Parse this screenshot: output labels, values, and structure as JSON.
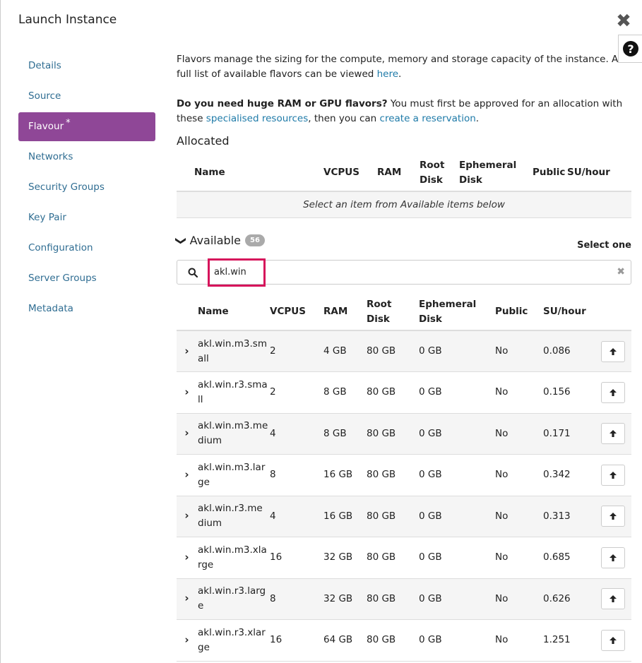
{
  "modal": {
    "title": "Launch Instance",
    "close_icon": "close-icon",
    "help_label": "?"
  },
  "nav": {
    "items": [
      {
        "label": "Details",
        "active": false,
        "required": false
      },
      {
        "label": "Source",
        "active": false,
        "required": false
      },
      {
        "label": "Flavour",
        "active": true,
        "required": true
      },
      {
        "label": "Networks",
        "active": false,
        "required": false
      },
      {
        "label": "Security Groups",
        "active": false,
        "required": false
      },
      {
        "label": "Key Pair",
        "active": false,
        "required": false
      },
      {
        "label": "Configuration",
        "active": false,
        "required": false
      },
      {
        "label": "Server Groups",
        "active": false,
        "required": false
      },
      {
        "label": "Metadata",
        "active": false,
        "required": false
      }
    ],
    "required_mark": "*"
  },
  "intro": {
    "p1_text": "Flavors manage the sizing for the compute, memory and storage capacity of the instance. A full list of available flavors can be viewed ",
    "p1_link": "here",
    "p1_end": ".",
    "p2_bold": "Do you need huge RAM or GPU flavors?",
    "p2_text": " You must first be approved for an allocation with these ",
    "p2_link1": "specialised resources",
    "p2_mid": ", then you can ",
    "p2_link2": "create a reservation",
    "p2_end": "."
  },
  "allocated": {
    "title": "Allocated",
    "columns": [
      "Name",
      "VCPUS",
      "RAM",
      "Root Disk",
      "Ephemeral Disk",
      "Public",
      "SU/hour"
    ],
    "empty_message": "Select an item from Available items below"
  },
  "available": {
    "title": "Available",
    "count": "56",
    "select_hint": "Select one",
    "search": {
      "value": "akl.win",
      "placeholder": ""
    },
    "columns": [
      "Name",
      "VCPUS",
      "RAM",
      "Root Disk",
      "Ephemeral Disk",
      "Public",
      "SU/hour"
    ],
    "rows": [
      {
        "name": "akl.win.m3.small",
        "vcpus": "2",
        "ram": "4 GB",
        "root_disk": "80 GB",
        "ephemeral_disk": "0 GB",
        "public": "No",
        "su_hour": "0.086"
      },
      {
        "name": "akl.win.r3.small",
        "vcpus": "2",
        "ram": "8 GB",
        "root_disk": "80 GB",
        "ephemeral_disk": "0 GB",
        "public": "No",
        "su_hour": "0.156"
      },
      {
        "name": "akl.win.m3.medium",
        "vcpus": "4",
        "ram": "8 GB",
        "root_disk": "80 GB",
        "ephemeral_disk": "0 GB",
        "public": "No",
        "su_hour": "0.171"
      },
      {
        "name": "akl.win.m3.large",
        "vcpus": "8",
        "ram": "16 GB",
        "root_disk": "80 GB",
        "ephemeral_disk": "0 GB",
        "public": "No",
        "su_hour": "0.342"
      },
      {
        "name": "akl.win.r3.medium",
        "vcpus": "4",
        "ram": "16 GB",
        "root_disk": "80 GB",
        "ephemeral_disk": "0 GB",
        "public": "No",
        "su_hour": "0.313"
      },
      {
        "name": "akl.win.m3.xlarge",
        "vcpus": "16",
        "ram": "32 GB",
        "root_disk": "80 GB",
        "ephemeral_disk": "0 GB",
        "public": "No",
        "su_hour": "0.685"
      },
      {
        "name": "akl.win.r3.large",
        "vcpus": "8",
        "ram": "32 GB",
        "root_disk": "80 GB",
        "ephemeral_disk": "0 GB",
        "public": "No",
        "su_hour": "0.626"
      },
      {
        "name": "akl.win.r3.xlarge",
        "vcpus": "16",
        "ram": "64 GB",
        "root_disk": "80 GB",
        "ephemeral_disk": "0 GB",
        "public": "No",
        "su_hour": "1.251"
      }
    ]
  },
  "colors": {
    "accent": "#8f4797",
    "link": "#1e7aa8",
    "highlight": "#d6145b"
  }
}
